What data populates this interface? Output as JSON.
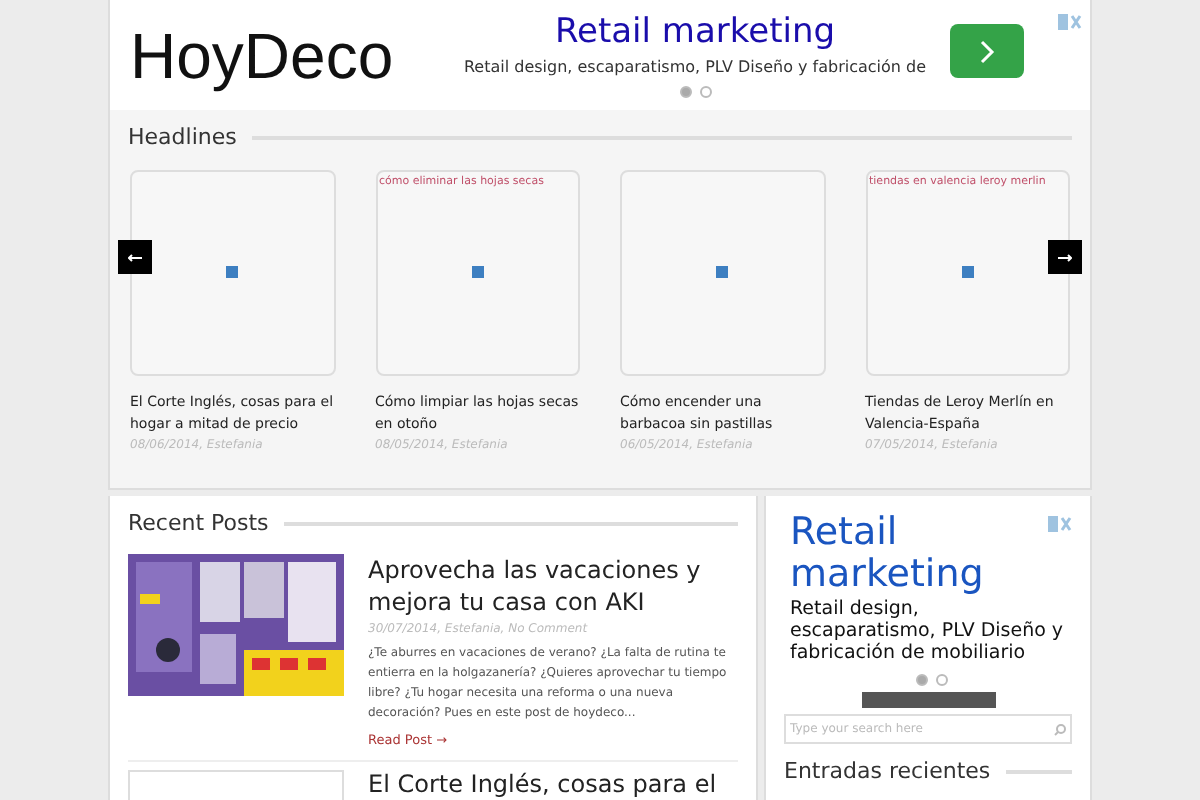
{
  "site": {
    "logo": "HoyDeco"
  },
  "header_ad": {
    "title": "Retail marketing",
    "text": "Retail design, escaparatismo, PLV Diseño y fabricación de",
    "dots": [
      {
        "selected": true
      },
      {
        "selected": false
      }
    ]
  },
  "headlines": {
    "title": "Headlines",
    "items": [
      {
        "title": "El Corte Inglés, cosas para el hogar a mitad de precio",
        "meta": "08/06/2014, Estefania"
      },
      {
        "caption": "cómo eliminar las hojas secas",
        "title": "Cómo limpiar las hojas secas en otoño",
        "meta": "08/05/2014, Estefania"
      },
      {
        "title": "Cómo encender una barbacoa sin pastillas",
        "meta": "06/05/2014, Estefania"
      },
      {
        "caption": "tiendas en valencia leroy merlin",
        "title": "Tiendas de Leroy Merlín en Valencia-España",
        "meta": "07/05/2014, Estefania"
      }
    ]
  },
  "recent_posts": {
    "title": "Recent Posts",
    "posts": [
      {
        "title": "Aprovecha las vacaciones y mejora tu casa con AKI",
        "meta": "30/07/2014, Estefania, No Comment",
        "excerpt": "¿Te aburres en vacaciones de verano? ¿La falta de rutina te entierra en la holgazanería? ¿Quieres aprovechar tu tiempo libre? ¿Tu hogar necesita una reforma o una nueva decoración? Pues en este post de hoydeco...",
        "link": "Read Post →"
      },
      {
        "title": "El Corte Inglés, cosas para el"
      }
    ]
  },
  "sidebar": {
    "ad": {
      "title": "Retail marketing",
      "text": "Retail design, escaparatismo, PLV Diseño y fabricación de mobiliario",
      "dots": [
        {
          "selected": true
        },
        {
          "selected": false
        }
      ]
    },
    "search": {
      "placeholder": "Type your search here"
    },
    "widget_title": "Entradas recientes"
  }
}
